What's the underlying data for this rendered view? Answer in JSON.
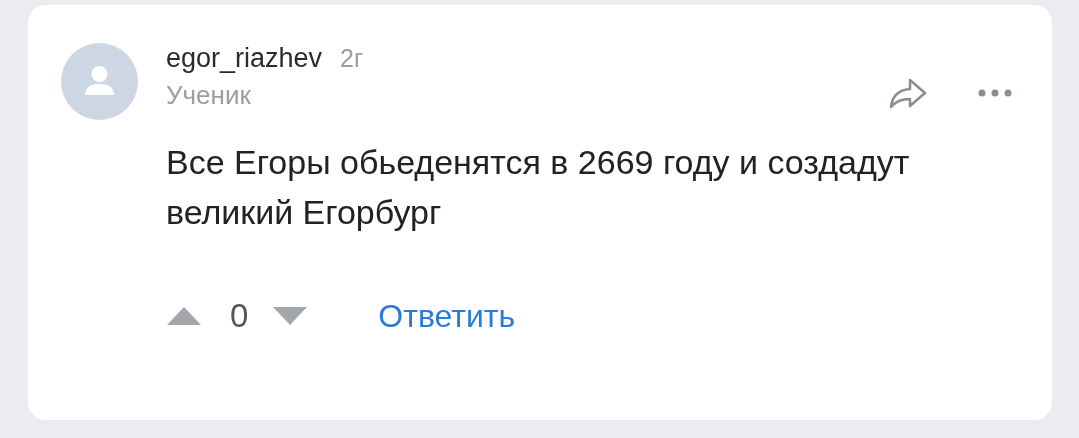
{
  "comment": {
    "author": "egor_riazhev",
    "age": "2г",
    "rank": "Ученик",
    "text": "Все Егоры обьеденятся в 2669 году и создадут великий Егорбург",
    "votes": "0",
    "reply": "Ответить"
  }
}
